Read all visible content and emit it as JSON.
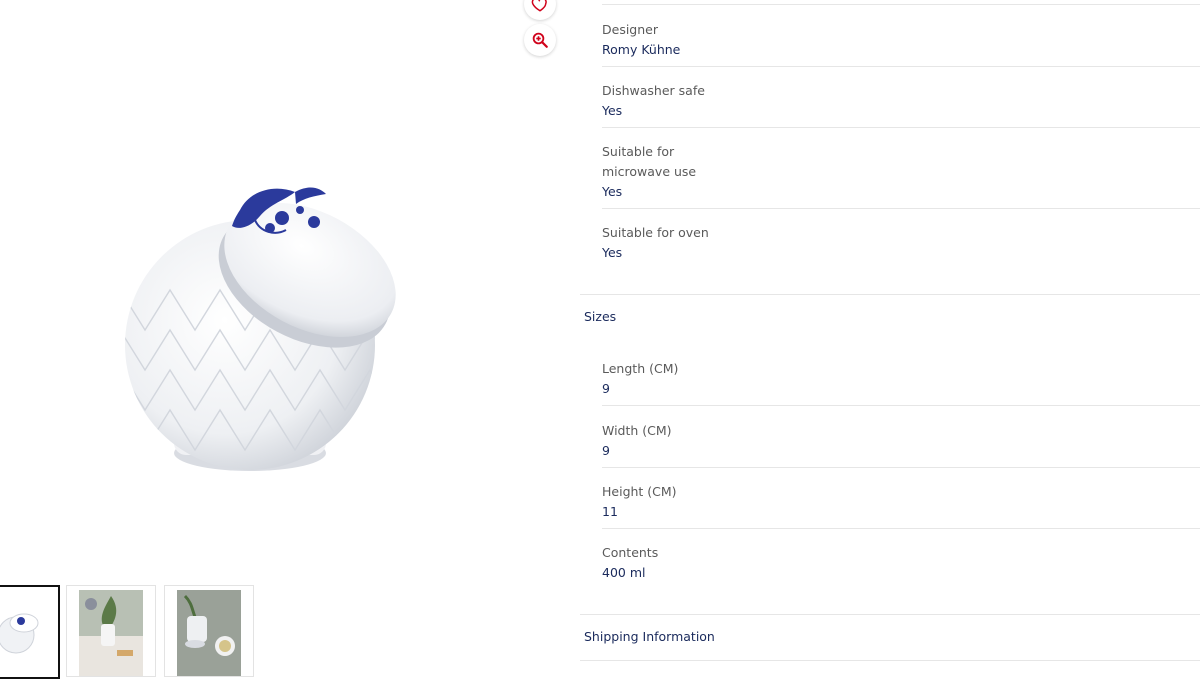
{
  "gallery": {
    "favorite_icon": "heart-icon",
    "zoom_icon": "zoom-in-icon",
    "thumbnails": [
      {
        "name": "thumbnail-sugar-bowl",
        "active": true
      },
      {
        "name": "thumbnail-table-scene",
        "active": false
      },
      {
        "name": "thumbnail-tea-setting",
        "active": false
      }
    ]
  },
  "materials": {
    "items": [
      {
        "label": "Designer",
        "value": "Romy Kühne"
      },
      {
        "label": "Dishwasher safe",
        "value": "Yes"
      },
      {
        "label": "Suitable for microwave use",
        "value": "Yes"
      },
      {
        "label": "Suitable for oven",
        "value": "Yes"
      }
    ]
  },
  "sizes": {
    "heading": "Sizes",
    "items": [
      {
        "label": "Length (CM)",
        "value": "9"
      },
      {
        "label": "Width (CM)",
        "value": "9"
      },
      {
        "label": "Height (CM)",
        "value": "11"
      },
      {
        "label": "Contents",
        "value": "400 ml"
      }
    ]
  },
  "shipping": {
    "heading": "Shipping Information"
  },
  "colors": {
    "accent_red": "#d0021b",
    "text_navy": "#1a2a5c",
    "label_gray": "#5a5a5a",
    "divider": "#e6e6e6"
  }
}
